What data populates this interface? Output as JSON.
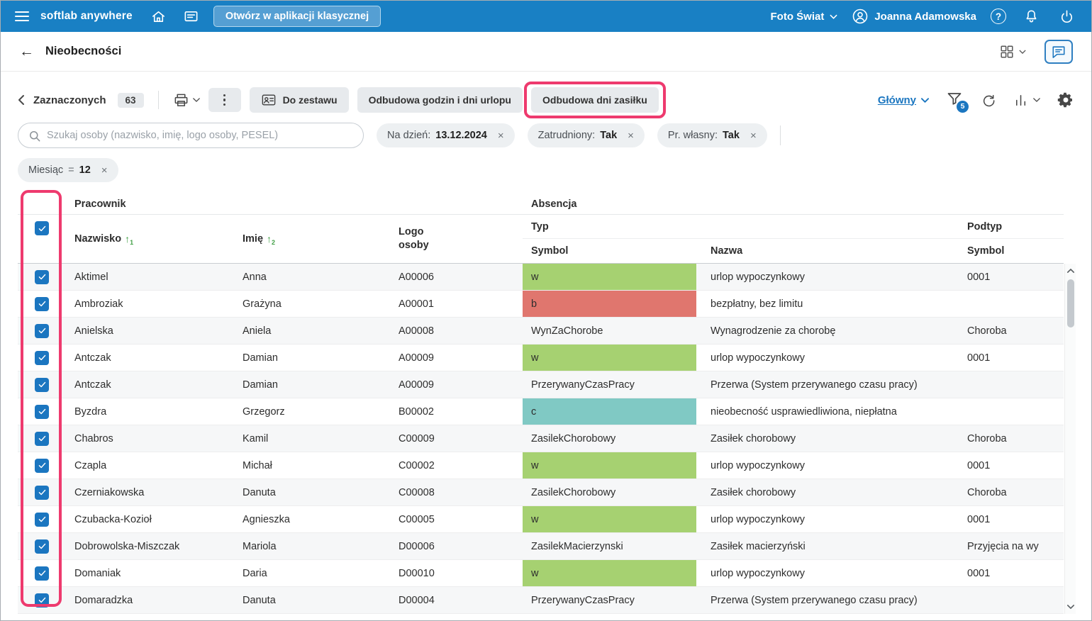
{
  "colors": {
    "accent": "#1b76c0",
    "topbar": "#1980c4",
    "annotation": "#ee3a6e"
  },
  "icons": {
    "help_glyph": "?"
  },
  "topbar": {
    "brand": "softlab anywhere",
    "open_classic": "Otwórz w aplikacji klasycznej",
    "company": "Foto Świat",
    "user": "Joanna Adamowska"
  },
  "titlebar": {
    "title": "Nieobecności"
  },
  "toolbar": {
    "selected_label": "Zaznaczonych",
    "selected_count": "63",
    "do_zestawu": "Do zestawu",
    "rebuild_hours": "Odbudowa godzin i dni urlopu",
    "rebuild_allowance": "Odbudowa dni zasiłku",
    "view_name": "Główny",
    "filter_count": "5"
  },
  "search": {
    "placeholder": "Szukaj osoby (nazwisko, imię, logo osoby, PESEL)"
  },
  "chips": [
    {
      "label": "Na dzień:",
      "value": "13.12.2024"
    },
    {
      "label": "Zatrudniony:",
      "value": "Tak"
    },
    {
      "label": "Pr. własny:",
      "value": "Tak"
    }
  ],
  "chip_month": {
    "label": "Miesiąc",
    "operator": "=",
    "value": "12"
  },
  "table": {
    "group_pracownik": "Pracownik",
    "group_absencja": "Absencja",
    "col_nazwisko": "Nazwisko",
    "col_imie": "Imię",
    "col_logo_1": "Logo",
    "col_logo_2": "osoby",
    "col_typ": "Typ",
    "col_symbol": "Symbol",
    "col_nazwa": "Nazwa",
    "col_podtyp": "Podtyp",
    "col_podtyp_symbol": "Symbol",
    "sort_nazwisko_order": "1",
    "sort_imie_order": "2",
    "symbol_colors": {
      "green": "#a6d171",
      "red": "#e0766e",
      "teal": "#80c9c4"
    },
    "rows": [
      {
        "nazwisko": "Aktimel",
        "imie": "Anna",
        "logo": "A00006",
        "symbol": "w",
        "symbol_color": "green",
        "nazwa": "urlop wypoczynkowy",
        "podtyp": "0001"
      },
      {
        "nazwisko": "Ambroziak",
        "imie": "Grażyna",
        "logo": "A00001",
        "symbol": "b",
        "symbol_color": "red",
        "nazwa": "bezpłatny, bez limitu",
        "podtyp": ""
      },
      {
        "nazwisko": "Anielska",
        "imie": "Aniela",
        "logo": "A00008",
        "symbol": "WynZaChorobe",
        "symbol_color": "none",
        "nazwa": "Wynagrodzenie za chorobę",
        "podtyp": "Choroba"
      },
      {
        "nazwisko": "Antczak",
        "imie": "Damian",
        "logo": "A00009",
        "symbol": "w",
        "symbol_color": "green",
        "nazwa": "urlop wypoczynkowy",
        "podtyp": "0001"
      },
      {
        "nazwisko": "Antczak",
        "imie": "Damian",
        "logo": "A00009",
        "symbol": "PrzerywanyCzasPracy",
        "symbol_color": "none",
        "nazwa": "Przerwa (System przerywanego czasu pracy)",
        "podtyp": ""
      },
      {
        "nazwisko": "Byzdra",
        "imie": "Grzegorz",
        "logo": "B00002",
        "symbol": "c",
        "symbol_color": "teal",
        "nazwa": "nieobecność usprawiedliwiona, niepłatna",
        "podtyp": ""
      },
      {
        "nazwisko": "Chabros",
        "imie": "Kamil",
        "logo": "C00009",
        "symbol": "ZasilekChorobowy",
        "symbol_color": "none",
        "nazwa": "Zasiłek chorobowy",
        "podtyp": "Choroba"
      },
      {
        "nazwisko": "Czapla",
        "imie": "Michał",
        "logo": "C00002",
        "symbol": "w",
        "symbol_color": "green",
        "nazwa": "urlop wypoczynkowy",
        "podtyp": "0001"
      },
      {
        "nazwisko": "Czerniakowska",
        "imie": "Danuta",
        "logo": "C00008",
        "symbol": "ZasilekChorobowy",
        "symbol_color": "none",
        "nazwa": "Zasiłek chorobowy",
        "podtyp": "Choroba"
      },
      {
        "nazwisko": "Czubacka-Kozioł",
        "imie": "Agnieszka",
        "logo": "C00005",
        "symbol": "w",
        "symbol_color": "green",
        "nazwa": "urlop wypoczynkowy",
        "podtyp": "0001"
      },
      {
        "nazwisko": "Dobrowolska-Miszczak",
        "imie": "Mariola",
        "logo": "D00006",
        "symbol": "ZasilekMacierzynski",
        "symbol_color": "none",
        "nazwa": "Zasiłek macierzyński",
        "podtyp": "Przyjęcia na wy"
      },
      {
        "nazwisko": "Domaniak",
        "imie": "Daria",
        "logo": "D00010",
        "symbol": "w",
        "symbol_color": "green",
        "nazwa": "urlop wypoczynkowy",
        "podtyp": "0001"
      },
      {
        "nazwisko": "Domaradzka",
        "imie": "Danuta",
        "logo": "D00004",
        "symbol": "PrzerywanyCzasPracy",
        "symbol_color": "none",
        "nazwa": "Przerwa (System przerywanego czasu pracy)",
        "podtyp": ""
      }
    ]
  }
}
